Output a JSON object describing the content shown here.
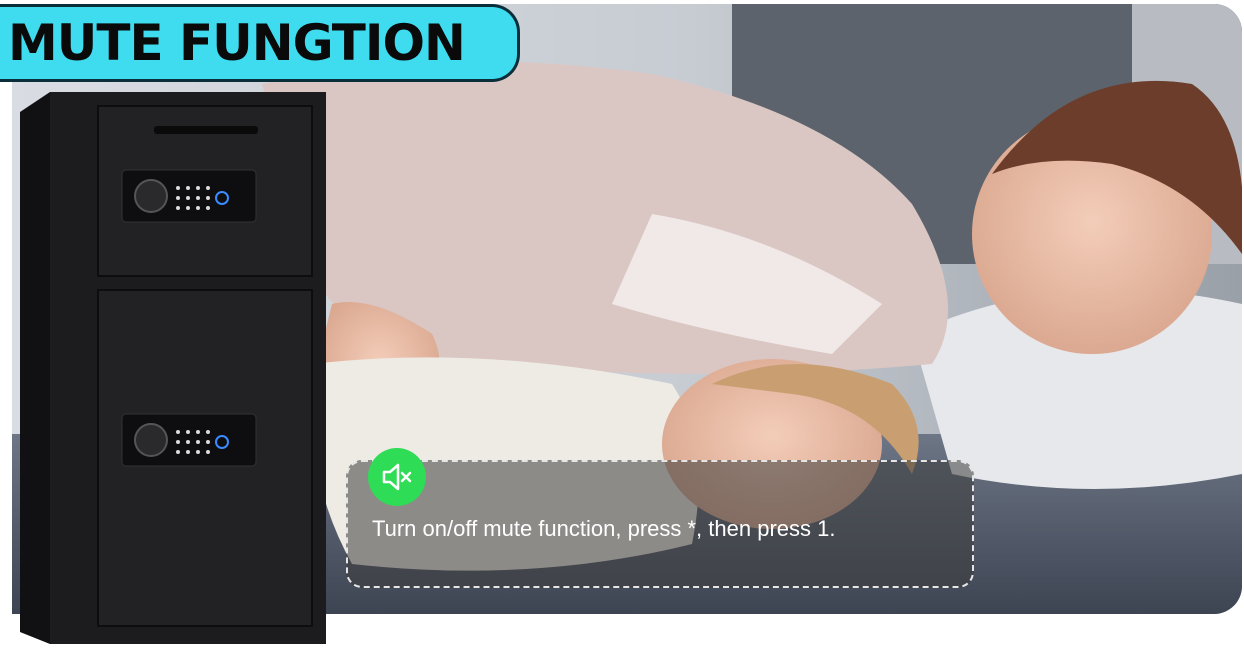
{
  "banner": {
    "title": "MUTE FUNGTION"
  },
  "callout": {
    "icon": "speaker-mute-icon",
    "text": "Turn on/off mute function, press *, then press 1."
  },
  "colors": {
    "banner": "#3fdcf0",
    "badge": "#2fdc55",
    "safe": "#1c1c1e"
  }
}
